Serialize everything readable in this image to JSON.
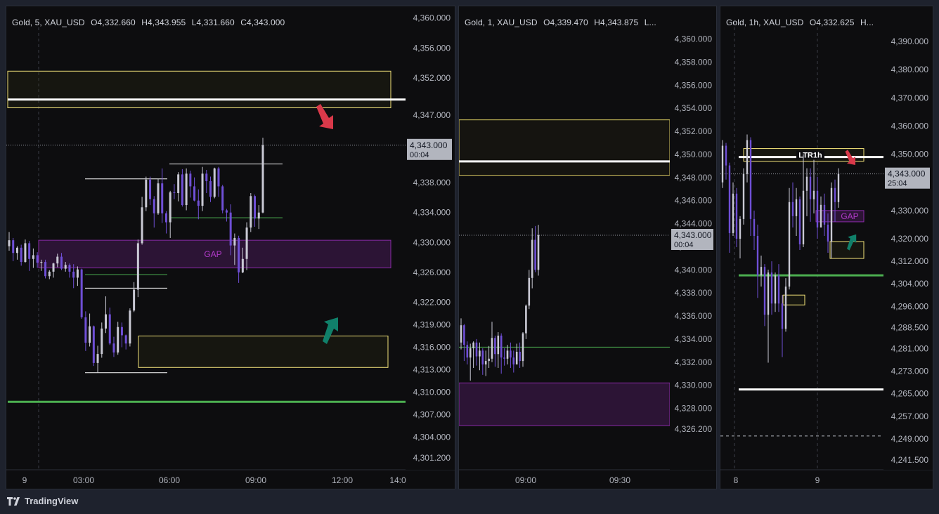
{
  "brand": {
    "name": "TradingView",
    "logo_icon": "tradingview-logo-icon"
  },
  "colors": {
    "background": "#0d0d0f",
    "frame": "#1e222d",
    "bull": "#c9c9d4",
    "bear": "#6f4fd6",
    "zone_yellow": "#f2e27a",
    "zone_purple": "#8a2aa8",
    "level_green": "#4caf50",
    "arrow_red": "#d9394a",
    "arrow_teal": "#10806a",
    "price_label_bg": "#b2b5be"
  },
  "chart_data": [
    {
      "id": "p1",
      "type": "candlestick",
      "legend": {
        "symbol": "Gold, 5, XAU_USD",
        "open": "O4,332.660",
        "high": "H4,343.955",
        "low": "L4,331.660",
        "close": "C4,343.000"
      },
      "ylim": [
        4300.0,
        4361.0
      ],
      "y_ticks": [
        "4,360.000",
        "4,356.000",
        "4,352.000",
        "4,347.000",
        "4,343.000",
        "4,338.000",
        "4,334.000",
        "4,330.000",
        "4,326.000",
        "4,322.000",
        "4,319.000",
        "4,316.000",
        "4,313.000",
        "4,310.000",
        "4,307.000",
        "4,304.000",
        "4,301.200"
      ],
      "x_labels": [
        "9",
        "03:00",
        "06:00",
        "09:00",
        "12:00",
        "14:0"
      ],
      "current_price": {
        "value": 4343.0,
        "label": "4,343.000",
        "countdown": "00:04"
      },
      "candles": [
        [
          4329.5,
          4330.3,
          4328.9,
          4331.4
        ],
        [
          4330.3,
          4328.6,
          4327.5,
          4330.6
        ],
        [
          4328.6,
          4329.3,
          4327.7,
          4329.5
        ],
        [
          4329.3,
          4327.4,
          4326.9,
          4329.7
        ],
        [
          4327.4,
          4329.9,
          4327.3,
          4330.4
        ],
        [
          4329.9,
          4327.8,
          4326.2,
          4330.2
        ],
        [
          4327.8,
          4328.3,
          4326.6,
          4329.2
        ],
        [
          4328.3,
          4327.3,
          4326.6,
          4328.7
        ],
        [
          4327.3,
          4327.4,
          4326.2,
          4327.7
        ],
        [
          4327.4,
          4325.5,
          4325.2,
          4327.7
        ],
        [
          4325.5,
          4326.1,
          4325.1,
          4326.3
        ],
        [
          4326.1,
          4327.2,
          4325.3,
          4327.3
        ],
        [
          4327.2,
          4328.1,
          4326.7,
          4328.5
        ],
        [
          4328.1,
          4326.5,
          4326.3,
          4328.6
        ],
        [
          4326.5,
          4327.0,
          4326.1,
          4327.4
        ],
        [
          4327.0,
          4326.1,
          4325.3,
          4327.2
        ],
        [
          4326.1,
          4325.3,
          4323.9,
          4327.1
        ],
        [
          4325.3,
          4326.4,
          4324.2,
          4326.8
        ],
        [
          4326.4,
          4320.0,
          4319.8,
          4326.5
        ],
        [
          4320.0,
          4316.6,
          4315.5,
          4320.8
        ],
        [
          4316.6,
          4318.8,
          4316.1,
          4320.5
        ],
        [
          4318.8,
          4313.9,
          4313.5,
          4318.9
        ],
        [
          4313.9,
          4315.1,
          4312.6,
          4316.2
        ],
        [
          4315.1,
          4318.5,
          4314.6,
          4319.3
        ],
        [
          4318.5,
          4320.4,
          4317.9,
          4322.8
        ],
        [
          4320.4,
          4316.5,
          4316.3,
          4321.3
        ],
        [
          4316.5,
          4315.3,
          4314.7,
          4317.4
        ],
        [
          4315.3,
          4318.7,
          4315.0,
          4319.4
        ],
        [
          4318.7,
          4317.6,
          4316.0,
          4319.3
        ],
        [
          4317.6,
          4316.5,
          4315.7,
          4317.7
        ],
        [
          4316.5,
          4320.9,
          4316.1,
          4321.2
        ],
        [
          4320.9,
          4323.7,
          4320.7,
          4324.7
        ],
        [
          4323.7,
          4329.9,
          4322.7,
          4330.4
        ],
        [
          4329.9,
          4334.7,
          4329.7,
          4336.1
        ],
        [
          4334.7,
          4338.4,
          4334.2,
          4338.8
        ],
        [
          4338.4,
          4335.8,
          4335.0,
          4338.8
        ],
        [
          4335.8,
          4333.9,
          4332.0,
          4336.2
        ],
        [
          4333.9,
          4337.9,
          4333.7,
          4338.5
        ],
        [
          4337.9,
          4333.9,
          4332.6,
          4339.9
        ],
        [
          4333.9,
          4332.7,
          4331.2,
          4334.2
        ],
        [
          4332.7,
          4336.7,
          4330.6,
          4336.9
        ],
        [
          4336.7,
          4336.6,
          4335.8,
          4337.8
        ],
        [
          4336.6,
          4339.1,
          4335.5,
          4339.4
        ],
        [
          4339.1,
          4335.0,
          4334.8,
          4339.8
        ],
        [
          4335.0,
          4339.2,
          4334.3,
          4339.9
        ],
        [
          4339.2,
          4337.5,
          4336.0,
          4339.6
        ],
        [
          4337.5,
          4335.6,
          4335.5,
          4338.7
        ],
        [
          4335.6,
          4334.9,
          4333.1,
          4337.1
        ],
        [
          4334.9,
          4339.2,
          4334.2,
          4340.1
        ],
        [
          4339.2,
          4338.2,
          4336.6,
          4339.7
        ],
        [
          4338.2,
          4336.1,
          4335.4,
          4338.8
        ],
        [
          4336.1,
          4339.9,
          4335.9,
          4340.0
        ],
        [
          4339.9,
          4337.5,
          4336.1,
          4340.1
        ],
        [
          4337.5,
          4334.3,
          4333.9,
          4337.7
        ],
        [
          4334.3,
          4334.0,
          4332.8,
          4334.5
        ],
        [
          4334.0,
          4329.6,
          4328.3,
          4335.1
        ],
        [
          4329.6,
          4330.6,
          4327.0,
          4331.2
        ],
        [
          4330.6,
          4326.0,
          4324.6,
          4330.9
        ],
        [
          4326.0,
          4327.8,
          4325.9,
          4329.3
        ],
        [
          4327.8,
          4332.0,
          4326.3,
          4332.7
        ],
        [
          4332.0,
          4336.2,
          4331.4,
          4336.6
        ],
        [
          4336.2,
          4333.2,
          4332.1,
          4336.4
        ],
        [
          4333.2,
          4334.0,
          4331.8,
          4335.0
        ],
        [
          4334.0,
          4343.0,
          4333.9,
          4344.0
        ]
      ],
      "zones": [
        {
          "type": "yellow",
          "top": 4352.9,
          "bottom": 4348.0
        },
        {
          "type": "purple",
          "top": 4330.3,
          "bottom": 4326.6,
          "label": "GAP"
        },
        {
          "type": "yellow",
          "top": 4317.5,
          "bottom": 4313.3
        }
      ],
      "lines": [
        {
          "type": "white-thick",
          "price": 4349.1
        },
        {
          "type": "green-thick",
          "price": 4308.7
        },
        {
          "type": "white",
          "price": 4338.5
        },
        {
          "type": "white",
          "price": 4340.5
        },
        {
          "type": "white",
          "price": 4323.9
        },
        {
          "type": "white",
          "price": 4312.6
        },
        {
          "type": "green",
          "price": 4333.3
        },
        {
          "type": "green",
          "price": 4325.7
        }
      ],
      "arrows": [
        {
          "color": "red",
          "direction": "down"
        },
        {
          "color": "teal",
          "direction": "up"
        }
      ]
    },
    {
      "id": "p2",
      "type": "candlestick",
      "legend": {
        "symbol": "Gold, 1, XAU_USD",
        "open": "O4,339.470",
        "high": "H4,343.875",
        "low": "L..."
      },
      "ylim": [
        4324.5,
        4361.5
      ],
      "y_ticks": [
        "4,360.000",
        "4,358.000",
        "4,356.000",
        "4,354.000",
        "4,352.000",
        "4,350.000",
        "4,348.000",
        "4,346.000",
        "4,344.000",
        "4,342.000",
        "4,340.000",
        "4,338.000",
        "4,336.000",
        "4,334.000",
        "4,332.000",
        "4,330.000",
        "4,328.000",
        "4,326.200"
      ],
      "x_labels": [
        "09:00",
        "09:30"
      ],
      "current_price": {
        "value": 4343.0,
        "label": "4,343.000",
        "countdown": "00:04"
      },
      "candles": [
        [
          4333.7,
          4335.2,
          4333.1,
          4335.8
        ],
        [
          4335.2,
          4333.5,
          4332.1,
          4335.3
        ],
        [
          4333.5,
          4332.4,
          4331.8,
          4333.8
        ],
        [
          4332.4,
          4333.2,
          4330.4,
          4333.6
        ],
        [
          4333.2,
          4333.7,
          4331.5,
          4333.8
        ],
        [
          4333.7,
          4332.5,
          4331.7,
          4334.0
        ],
        [
          4332.5,
          4333.0,
          4331.3,
          4333.7
        ],
        [
          4333.0,
          4331.8,
          4330.9,
          4333.2
        ],
        [
          4331.8,
          4332.1,
          4330.8,
          4333.0
        ],
        [
          4332.1,
          4332.3,
          4331.5,
          4333.4
        ],
        [
          4332.3,
          4334.1,
          4332.0,
          4335.5
        ],
        [
          4334.1,
          4332.7,
          4331.6,
          4334.3
        ],
        [
          4332.7,
          4334.3,
          4331.5,
          4334.6
        ],
        [
          4334.3,
          4332.4,
          4331.0,
          4334.5
        ],
        [
          4332.4,
          4332.3,
          4331.7,
          4333.2
        ],
        [
          4332.3,
          4333.0,
          4331.8,
          4333.5
        ],
        [
          4333.0,
          4332.4,
          4331.5,
          4333.7
        ],
        [
          4332.4,
          4331.8,
          4331.1,
          4333.0
        ],
        [
          4331.8,
          4332.9,
          4331.8,
          4333.6
        ],
        [
          4332.9,
          4332.1,
          4331.5,
          4333.7
        ],
        [
          4332.1,
          4334.5,
          4331.6,
          4334.6
        ],
        [
          4334.5,
          4336.9,
          4334.0,
          4337.0
        ],
        [
          4336.9,
          4339.3,
          4336.6,
          4340.0
        ],
        [
          4339.3,
          4342.6,
          4338.4,
          4343.6
        ],
        [
          4342.6,
          4340.0,
          4339.8,
          4343.8
        ],
        [
          4340.0,
          4343.0,
          4339.5,
          4343.9
        ]
      ],
      "zones": [
        {
          "type": "yellow-dark",
          "top": 4353.0,
          "bottom": 4348.2
        },
        {
          "type": "purple",
          "top": 4330.2,
          "bottom": 4326.5
        }
      ],
      "lines": [
        {
          "type": "white-thick",
          "price": 4349.4
        },
        {
          "type": "green",
          "price": 4333.3
        }
      ]
    },
    {
      "id": "p3",
      "type": "candlestick",
      "legend": {
        "symbol": "Gold, 1h, XAU_USD",
        "open": "O4,332.625",
        "high": "H..."
      },
      "ylim": [
        4238.0,
        4397.0
      ],
      "y_ticks": [
        "4,390.000",
        "4,380.000",
        "4,370.000",
        "4,360.000",
        "4,350.000",
        "4,343.000",
        "4,330.000",
        "4,320.000",
        "4,312.000",
        "4,304.000",
        "4,296.000",
        "4,288.500",
        "4,281.000",
        "4,273.000",
        "4,265.000",
        "4,257.000",
        "4,249.000",
        "4,241.500"
      ],
      "x_labels": [
        "8",
        "9"
      ],
      "current_price": {
        "value": 4343.0,
        "label": "4,343.000",
        "countdown": "25:04"
      },
      "candles": [
        [
          4340.0,
          4353.0,
          4338.0,
          4355.0
        ],
        [
          4353.0,
          4346.0,
          4341.0,
          4354.0
        ],
        [
          4346.0,
          4322.0,
          4315.0,
          4347.0
        ],
        [
          4322.0,
          4336.0,
          4321.0,
          4340.0
        ],
        [
          4336.0,
          4320.0,
          4317.0,
          4338.0
        ],
        [
          4320.0,
          4327.0,
          4313.0,
          4328.0
        ],
        [
          4327.0,
          4343.0,
          4325.0,
          4345.0
        ],
        [
          4343.0,
          4355.0,
          4340.0,
          4357.0
        ],
        [
          4355.0,
          4327.0,
          4321.0,
          4356.0
        ],
        [
          4327.0,
          4321.0,
          4316.0,
          4330.0
        ],
        [
          4321.0,
          4307.0,
          4299.0,
          4325.0
        ],
        [
          4307.0,
          4310.0,
          4303.0,
          4314.0
        ],
        [
          4310.0,
          4293.0,
          4289.0,
          4311.0
        ],
        [
          4293.0,
          4308.0,
          4276.0,
          4309.0
        ],
        [
          4308.0,
          4297.0,
          4293.0,
          4312.0
        ],
        [
          4297.0,
          4307.0,
          4294.0,
          4308.0
        ],
        [
          4307.0,
          4297.0,
          4294.0,
          4311.0
        ],
        [
          4297.0,
          4288.0,
          4278.0,
          4300.0
        ],
        [
          4288.0,
          4303.0,
          4287.0,
          4306.0
        ],
        [
          4303.0,
          4333.0,
          4302.0,
          4338.0
        ],
        [
          4333.0,
          4328.0,
          4324.0,
          4340.0
        ],
        [
          4328.0,
          4334.0,
          4321.0,
          4338.0
        ],
        [
          4334.0,
          4318.0,
          4316.0,
          4335.0
        ],
        [
          4318.0,
          4337.0,
          4317.0,
          4350.0
        ],
        [
          4337.0,
          4342.0,
          4328.0,
          4345.0
        ],
        [
          4342.0,
          4334.0,
          4326.0,
          4345.0
        ],
        [
          4334.0,
          4337.0,
          4329.0,
          4348.0
        ],
        [
          4337.0,
          4324.0,
          4320.0,
          4342.0
        ],
        [
          4324.0,
          4332.0,
          4324.0,
          4335.0
        ],
        [
          4332.0,
          4325.0,
          4321.0,
          4336.0
        ],
        [
          4325.0,
          4319.0,
          4315.0,
          4329.0
        ],
        [
          4319.0,
          4338.0,
          4313.0,
          4340.0
        ],
        [
          4338.0,
          4333.0,
          4326.0,
          4341.0
        ],
        [
          4333.0,
          4343.0,
          4331.0,
          4345.0
        ]
      ],
      "zones": [
        {
          "type": "yellow",
          "top": 4352.0,
          "bottom": 4347.5
        },
        {
          "type": "purple",
          "top": 4330.0,
          "bottom": 4326.0,
          "label": "GAP"
        },
        {
          "type": "yellow",
          "top": 4319.0,
          "bottom": 4313.0
        },
        {
          "type": "yellow",
          "top": 4300.0,
          "bottom": 4296.5
        }
      ],
      "lines": [
        {
          "type": "white-thick",
          "price": 4349.0,
          "label": "LTR1h"
        },
        {
          "type": "green-thick",
          "price": 4307.0
        },
        {
          "type": "white-thick",
          "price": 4266.5
        },
        {
          "type": "white-dashed",
          "price": 4250.0
        }
      ],
      "arrows": [
        {
          "color": "red",
          "direction": "down"
        },
        {
          "color": "teal",
          "direction": "up"
        }
      ]
    }
  ]
}
